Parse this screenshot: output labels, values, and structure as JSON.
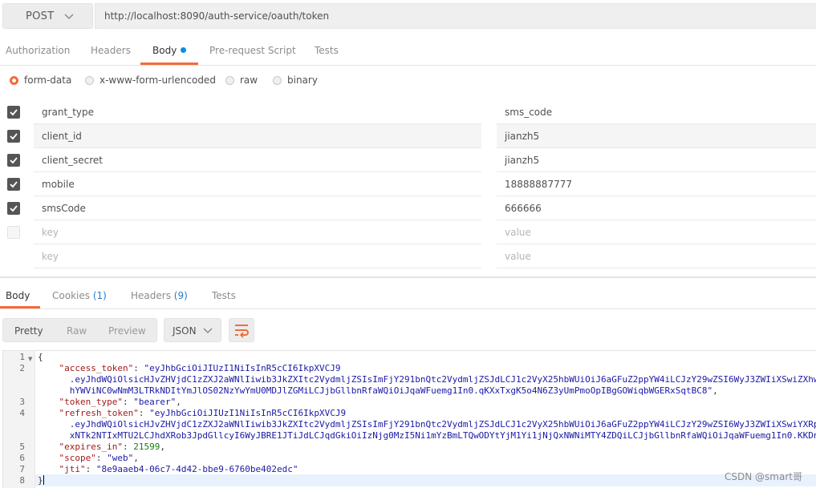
{
  "request": {
    "method": "POST",
    "url": "http://localhost:8090/auth-service/oauth/token"
  },
  "tabs": [
    {
      "label": "Authorization"
    },
    {
      "label": "Headers"
    },
    {
      "label": "Body"
    },
    {
      "label": "Pre-request Script"
    },
    {
      "label": "Tests"
    }
  ],
  "body_types": [
    {
      "label": "form-data",
      "selected": true
    },
    {
      "label": "x-www-form-urlencoded",
      "selected": false
    },
    {
      "label": "raw",
      "selected": false
    },
    {
      "label": "binary",
      "selected": false
    }
  ],
  "form": {
    "rows": [
      {
        "key": "grant_type",
        "value": "sms_code",
        "checked": true
      },
      {
        "key": "client_id",
        "value": "jianzh5",
        "checked": true
      },
      {
        "key": "client_secret",
        "value": "jianzh5",
        "checked": true
      },
      {
        "key": "mobile",
        "value": "18888887777",
        "checked": true
      },
      {
        "key": "smsCode",
        "value": "666666",
        "checked": true
      }
    ],
    "placeholder_key": "key",
    "placeholder_value": "value"
  },
  "response": {
    "tabs": [
      {
        "label": "Body",
        "count": ""
      },
      {
        "label": "Cookies",
        "count": "(1)"
      },
      {
        "label": "Headers",
        "count": "(9)"
      },
      {
        "label": "Tests",
        "count": ""
      }
    ],
    "views": [
      "Pretty",
      "Raw",
      "Preview"
    ],
    "format": "JSON",
    "line_numbers": [
      "1",
      "2",
      "3",
      "4",
      "5",
      "6",
      "7",
      "8"
    ],
    "code": {
      "open": "{",
      "access_token_key": "\"access_token\"",
      "access_token_l1": "\"eyJhbGciOiJIUzI1NiIsInR5cCI6IkpXVCJ9",
      "access_token_l2": ".eyJhdWQiOlsicHJvZHVjdC1zZXJ2aWNlIiwib3JkZXItc2VydmljZSIsImFjY291bnQtc2VydmljZSJdLCJ1c2VyX25hbWUiOiJ6aGFuZ2ppYW4iLCJzY29wZSI6WyJ3ZWIiXSwiZXhw",
      "access_token_l3": "hYWViNC0wNmM3LTRkNDItYmJlOS02NzYwYmU0MDJlZGMiLCJjbGllbnRfaWQiOiJqaWFuemg1In0.qKXxTxgK5o4N6Z3yUmPmoOpIBgGOWiqbWGERxSqtBC8\"",
      "token_type_key": "\"token_type\"",
      "token_type_val": "\"bearer\"",
      "refresh_token_key": "\"refresh_token\"",
      "refresh_token_l1": "\"eyJhbGciOiJIUzI1NiIsInR5cCI6IkpXVCJ9",
      "refresh_token_l2": ".eyJhdWQiOlsicHJvZHVjdC1zZXJ2aWNlIiwib3JkZXItc2VydmljZSIsImFjY291bnQtc2VydmljZSJdLCJ1c2VyX25hbWUiOiJ6aGFuZ2ppYW4iLCJzY29wZSI6WyJ3ZWIiXSwiYXRp",
      "refresh_token_l3": "xNTk2NTIxMTU2LCJhdXRob3JpdGllcyI6WyJBRE1JTiJdLCJqdGkiOiIzNjg0MzI5Ni1mYzBmLTQwODYtYjM1Yi1jNjQxNWNiMTY4ZDQiLCJjbGllbnRfaWQiOiJqaWFuemg1In0.KKDn",
      "expires_in_key": "\"expires_in\"",
      "expires_in_val": "21599",
      "scope_key": "\"scope\"",
      "scope_val": "\"web\"",
      "jti_key": "\"jti\"",
      "jti_val": "\"8e9aaeb4-06c7-4d42-bbe9-6760be402edc\"",
      "close": "}"
    }
  },
  "watermark": "CSDN @smart哥",
  "colors": {
    "accent": "#f26b3a",
    "dot": "#0a8de3",
    "json_key": "#a41a1a",
    "json_string": "#1a1aa6",
    "json_number": "#1a7a1a"
  }
}
